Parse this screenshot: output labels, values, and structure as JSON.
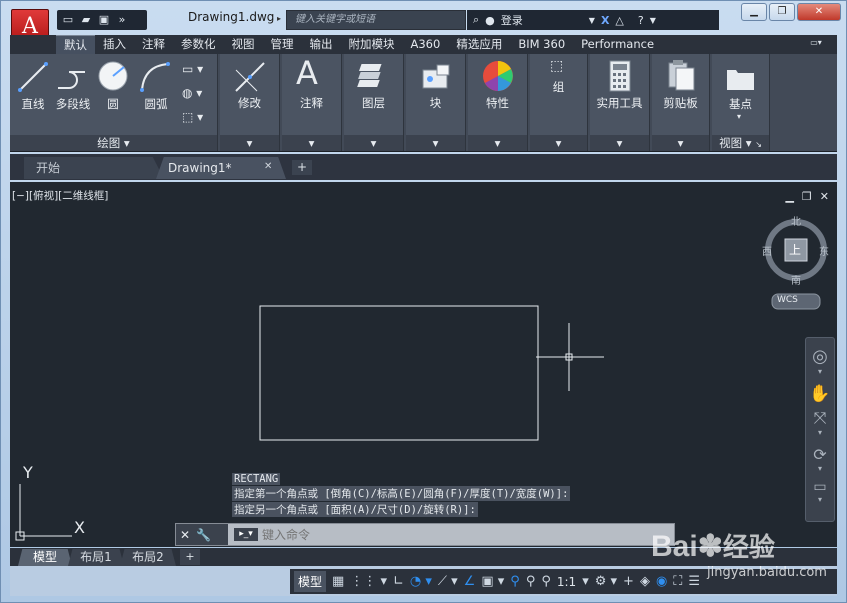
{
  "title_bar": {
    "document_title": "Drawing1.dwg",
    "search_placeholder": "键入关键字或短语",
    "login_label": "登录",
    "window_controls": [
      "minimize-icon",
      "restore-icon",
      "close-icon"
    ]
  },
  "quick_access": [
    "new-icon",
    "open-icon",
    "save-icon",
    "more-icon"
  ],
  "ribbon_tabs": [
    "默认",
    "插入",
    "注释",
    "参数化",
    "视图",
    "管理",
    "输出",
    "附加模块",
    "A360",
    "精选应用",
    "BIM 360",
    "Performance"
  ],
  "active_tab": "默认",
  "ribbon_panels": {
    "draw": {
      "footer": "绘图",
      "tools": [
        "直线",
        "多段线",
        "圆",
        "圆弧"
      ]
    },
    "modify": {
      "label": "修改"
    },
    "annotation": {
      "label": "注释"
    },
    "layers": {
      "label": "图层"
    },
    "block": {
      "label": "块"
    },
    "properties": {
      "label": "特性"
    },
    "groups": {
      "label": "组"
    },
    "utilities": {
      "label": "实用工具"
    },
    "clipboard": {
      "label": "剪贴板"
    },
    "view": {
      "tool": "基点",
      "footer": "视图"
    }
  },
  "document_tabs": {
    "start": "开始",
    "drawing": "Drawing1*"
  },
  "viewport": {
    "label": "[−][俯视][二维线框]",
    "viewcube": {
      "north": "北",
      "south": "南",
      "east": "东",
      "west": "西",
      "top": "上",
      "wcs": "WCS"
    },
    "ucs_x": "X",
    "ucs_y": "Y"
  },
  "command_history": [
    "RECTANG",
    "指定第一个角点或 [倒角(C)/标高(E)/圆角(F)/厚度(T)/宽度(W)]:",
    "指定另一个角点或 [面积(A)/尺寸(D)/旋转(R)]:"
  ],
  "command_input": {
    "placeholder": "键入命令"
  },
  "layout_tabs": [
    "模型",
    "布局1",
    "布局2"
  ],
  "active_layout": "模型",
  "status_bar": {
    "model_label": "模型",
    "scale": "1:1"
  },
  "watermark": {
    "brand": "Bai",
    "brand2": "经验",
    "url": "jingyan.baidu.com"
  }
}
